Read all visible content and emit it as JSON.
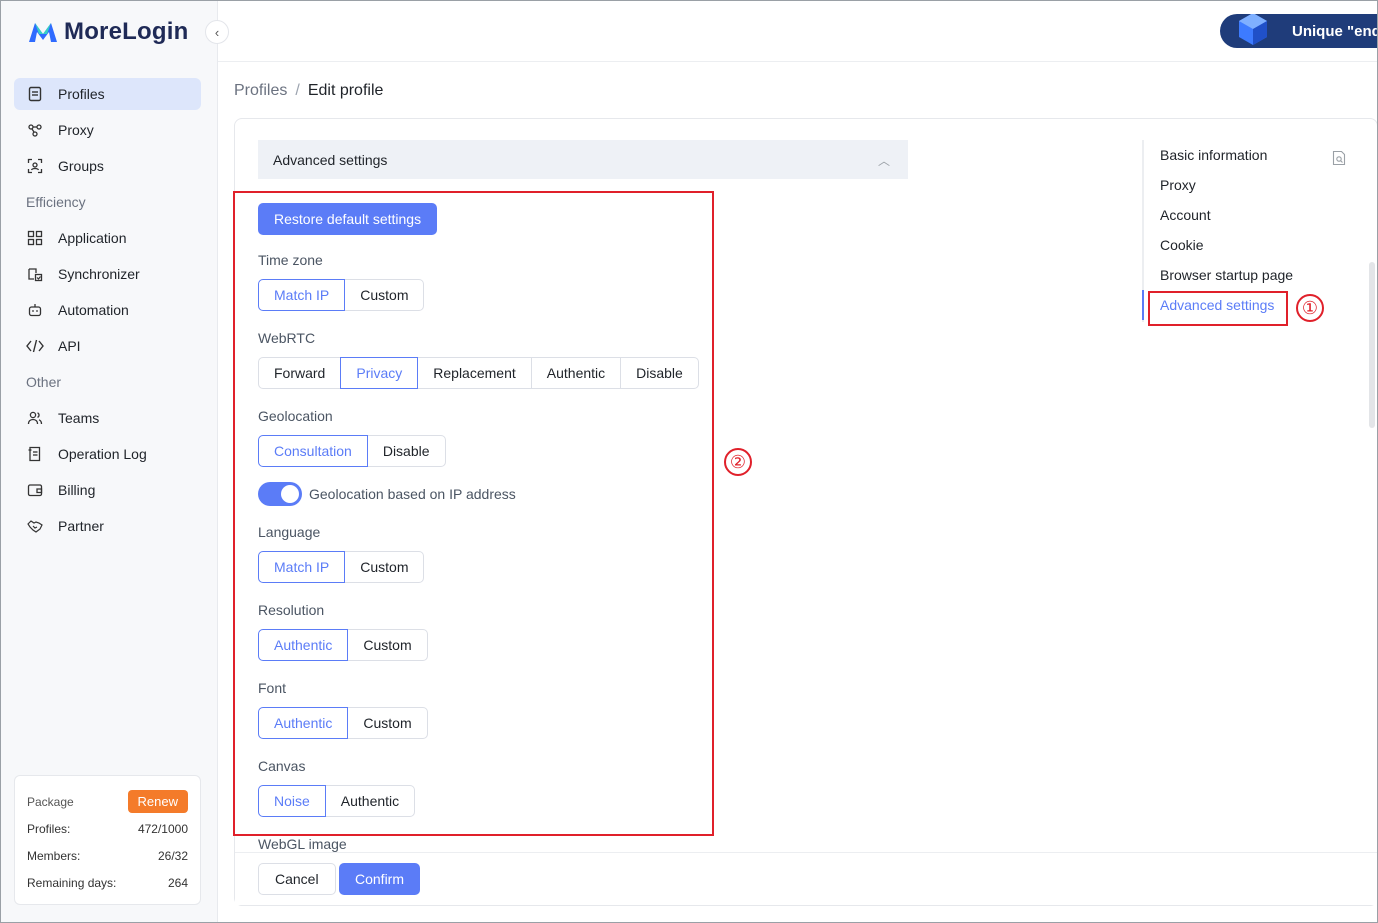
{
  "app": {
    "name": "MoreLogin"
  },
  "promo": {
    "text": "Unique \"end"
  },
  "sidebar": {
    "items": [
      {
        "label": "Profiles",
        "icon": "profiles-icon",
        "active": true
      },
      {
        "label": "Proxy",
        "icon": "proxy-icon"
      },
      {
        "label": "Groups",
        "icon": "groups-icon"
      }
    ],
    "efficiency_title": "Efficiency",
    "efficiency": [
      {
        "label": "Application",
        "icon": "application-icon"
      },
      {
        "label": "Synchronizer",
        "icon": "synchronizer-icon"
      },
      {
        "label": "Automation",
        "icon": "automation-icon"
      },
      {
        "label": "API",
        "icon": "api-icon"
      }
    ],
    "other_title": "Other",
    "other": [
      {
        "label": "Teams",
        "icon": "teams-icon"
      },
      {
        "label": "Operation Log",
        "icon": "operation-log-icon"
      },
      {
        "label": "Billing",
        "icon": "billing-icon"
      },
      {
        "label": "Partner",
        "icon": "partner-icon"
      }
    ]
  },
  "package": {
    "title": "Package",
    "renew": "Renew",
    "rows": [
      {
        "label": "Profiles:",
        "value": "472/1000"
      },
      {
        "label": "Members:",
        "value": "26/32"
      },
      {
        "label": "Remaining days:",
        "value": "264"
      }
    ]
  },
  "breadcrumb": {
    "parent": "Profiles",
    "separator": "/",
    "current": "Edit profile"
  },
  "section": {
    "title": "Advanced settings"
  },
  "restore_button": "Restore default settings",
  "fields": {
    "timezone": {
      "label": "Time zone",
      "options": [
        "Match IP",
        "Custom"
      ],
      "selected": "Match IP"
    },
    "webrtc": {
      "label": "WebRTC",
      "options": [
        "Forward",
        "Privacy",
        "Replacement",
        "Authentic",
        "Disable"
      ],
      "selected": "Privacy"
    },
    "geolocation": {
      "label": "Geolocation",
      "options": [
        "Consultation",
        "Disable"
      ],
      "selected": "Consultation"
    },
    "geo_toggle": {
      "label": "Geolocation based on IP address",
      "on": true
    },
    "language": {
      "label": "Language",
      "options": [
        "Match IP",
        "Custom"
      ],
      "selected": "Match IP"
    },
    "resolution": {
      "label": "Resolution",
      "options": [
        "Authentic",
        "Custom"
      ],
      "selected": "Authentic"
    },
    "font": {
      "label": "Font",
      "options": [
        "Authentic",
        "Custom"
      ],
      "selected": "Authentic"
    },
    "canvas": {
      "label": "Canvas",
      "options": [
        "Noise",
        "Authentic"
      ],
      "selected": "Noise"
    },
    "webgl_image": {
      "label": "WebGL image"
    }
  },
  "footer": {
    "cancel": "Cancel",
    "confirm": "Confirm"
  },
  "anchor_nav": {
    "items": [
      "Basic information",
      "Proxy",
      "Account",
      "Cookie",
      "Browser startup page",
      "Advanced settings"
    ],
    "active": "Advanced settings"
  },
  "annotations": {
    "one": "①",
    "two": "②"
  },
  "colors": {
    "primary": "#5b7cf7",
    "renew": "#f47b2a",
    "annotation": "#e0202a",
    "brand": "#1f2a56"
  }
}
